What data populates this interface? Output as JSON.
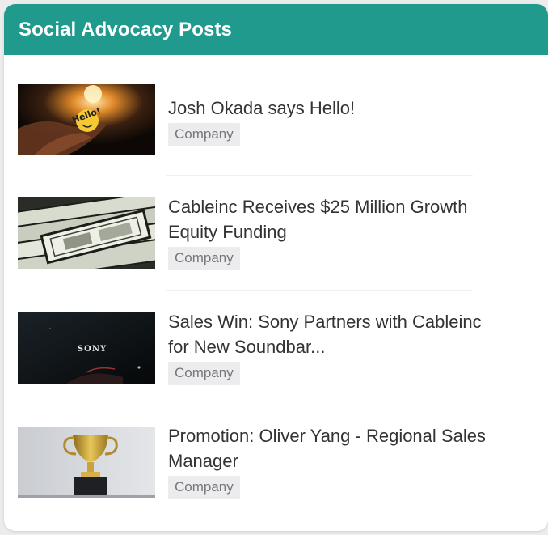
{
  "header": {
    "title": "Social Advocacy Posts"
  },
  "posts": [
    {
      "title": "Josh Okada says Hello!",
      "tag": "Company",
      "thumbnail": "hello-match-image",
      "badge_text": "Hello!"
    },
    {
      "title": "Cableinc Receives $25 Million Growth Equity Funding",
      "tag": "Company",
      "thumbnail": "money-bills-image"
    },
    {
      "title": "Sales Win: Sony Partners with Cableinc for New Soundbar...",
      "tag": "Company",
      "thumbnail": "sony-logo-image",
      "logo_text": "SONY"
    },
    {
      "title": "Promotion: Oliver Yang - Regional Sales Manager",
      "tag": "Company",
      "thumbnail": "trophy-image"
    }
  ],
  "colors": {
    "header_bg": "#1f9a8c",
    "header_text": "#ffffff",
    "tag_bg": "#ececef",
    "tag_text": "#777777"
  }
}
